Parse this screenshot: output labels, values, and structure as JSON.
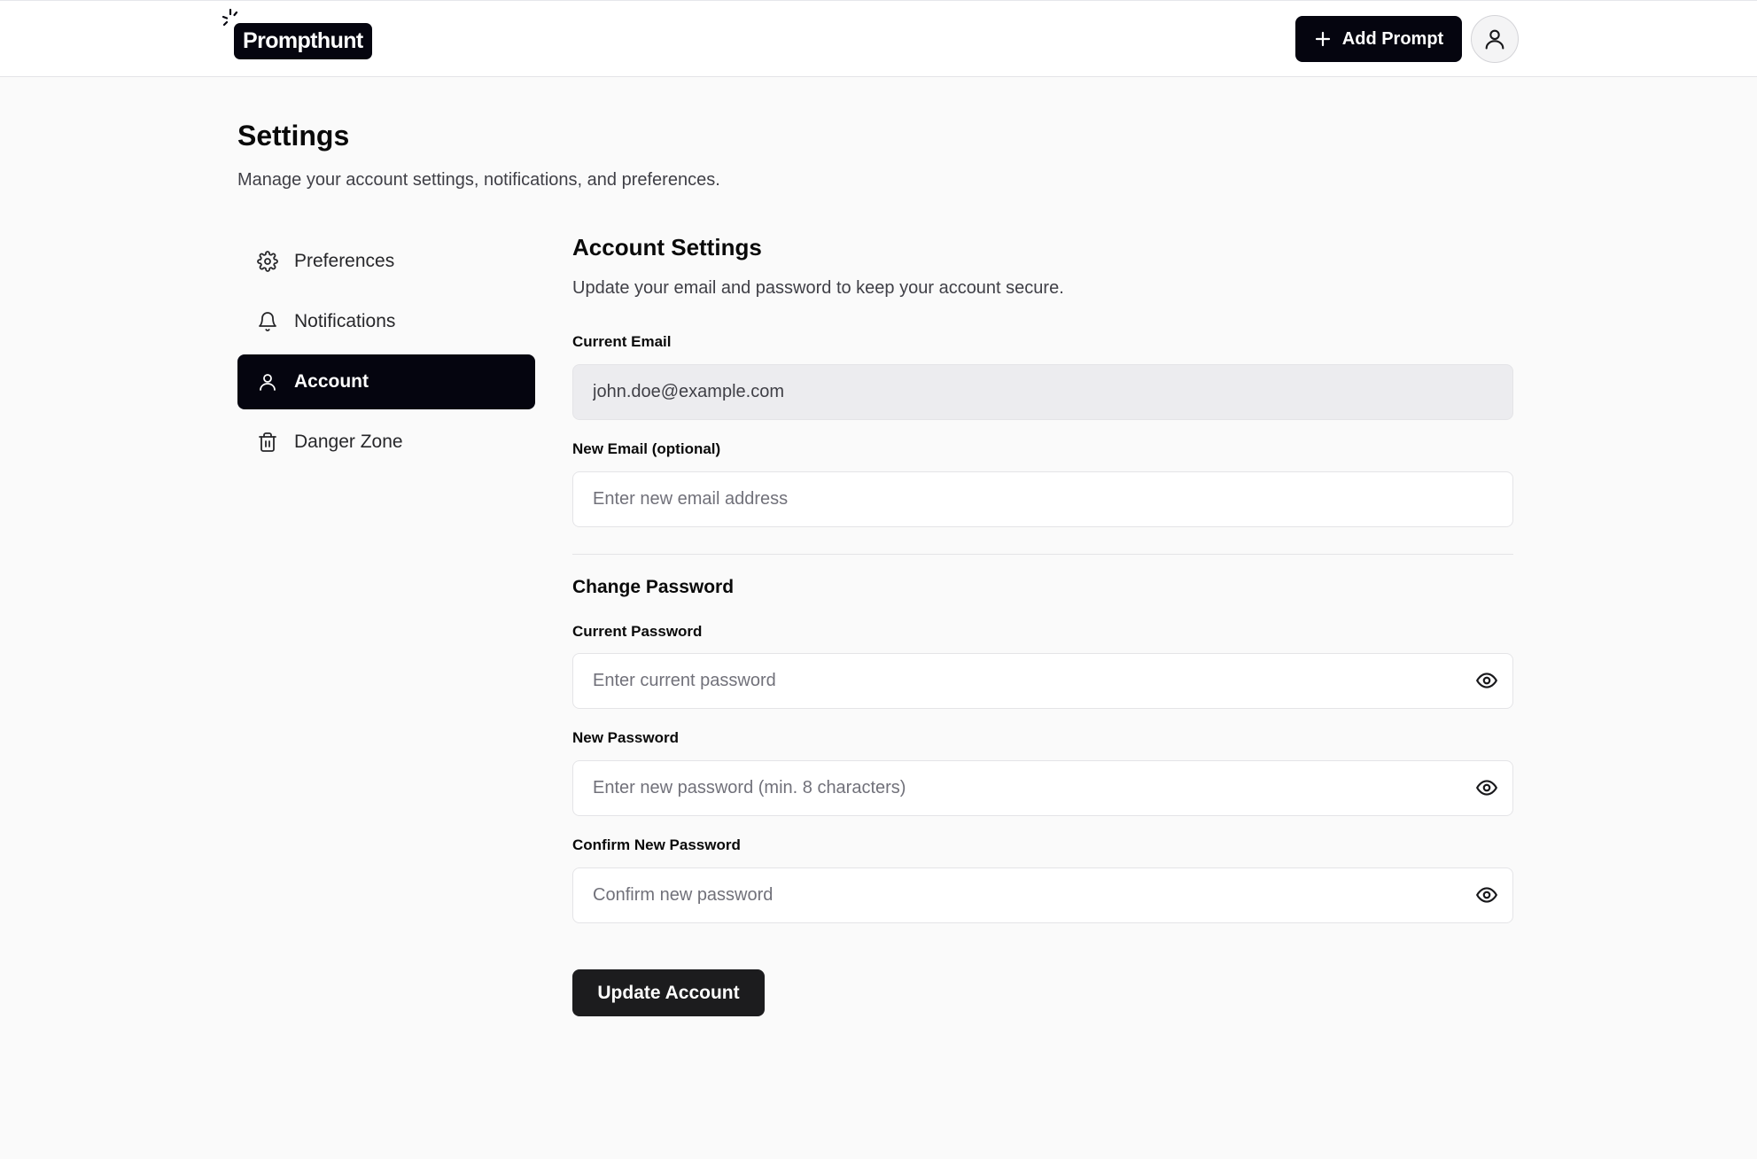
{
  "brand": {
    "name": "Prompthunt"
  },
  "header": {
    "add_button_label": "Add Prompt",
    "add_icon": "plus-icon",
    "avatar_icon": "user-icon"
  },
  "page": {
    "title": "Settings",
    "subtitle": "Manage your account settings, notifications, and preferences."
  },
  "sidebar": {
    "items": [
      {
        "label": "Preferences",
        "icon": "gear-icon",
        "active": false
      },
      {
        "label": "Notifications",
        "icon": "bell-icon",
        "active": false
      },
      {
        "label": "Account",
        "icon": "user-icon",
        "active": true
      },
      {
        "label": "Danger Zone",
        "icon": "trash-icon",
        "active": false
      }
    ]
  },
  "account": {
    "title": "Account Settings",
    "subtitle": "Update your email and password to keep your account secure.",
    "current_email": {
      "label": "Current Email",
      "value": "john.doe@example.com"
    },
    "new_email": {
      "label": "New Email (optional)",
      "placeholder": "Enter new email address"
    },
    "password_section_title": "Change Password",
    "current_password": {
      "label": "Current Password",
      "placeholder": "Enter current password"
    },
    "new_password": {
      "label": "New Password",
      "placeholder": "Enter new password (min. 8 characters)"
    },
    "confirm_password": {
      "label": "Confirm New Password",
      "placeholder": "Confirm new password"
    },
    "submit_label": "Update Account"
  },
  "colors": {
    "primary": "#05050f",
    "background": "#fafafa",
    "border": "#e4e4e7",
    "disabled_field": "#ececef"
  }
}
